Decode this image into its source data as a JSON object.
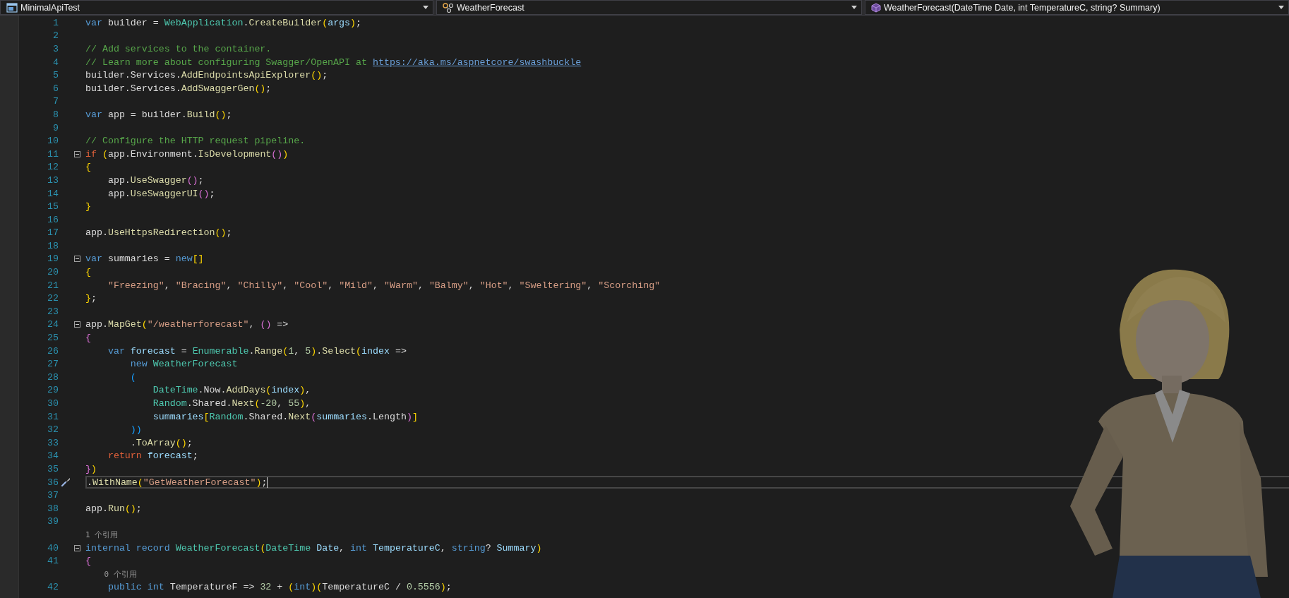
{
  "nav_bar": [
    {
      "label": "MinimalApiTest",
      "kind": "project"
    },
    {
      "label": "WeatherForecast",
      "kind": "class"
    },
    {
      "label": "WeatherForecast(DateTime Date, int TemperatureC, string? Summary)",
      "kind": "member"
    }
  ],
  "lines": [
    {
      "kind": "code",
      "number": "1",
      "fold": false,
      "current": false,
      "tokens": [
        {
          "kind": "kw",
          "text": "var"
        },
        {
          "kind": "p",
          "text": " builder = "
        },
        {
          "kind": "type",
          "text": "WebApplication"
        },
        {
          "kind": "p",
          "text": "."
        },
        {
          "kind": "fn",
          "text": "CreateBuilder"
        },
        {
          "kind": "b1",
          "text": "("
        },
        {
          "kind": "var",
          "text": "args"
        },
        {
          "kind": "b1",
          "text": ")"
        },
        {
          "kind": "p",
          "text": ";"
        }
      ]
    },
    {
      "kind": "code",
      "number": "2",
      "fold": false,
      "current": false
    },
    {
      "kind": "code",
      "number": "3",
      "fold": false,
      "current": false,
      "tokens": [
        {
          "kind": "cm",
          "text": "// Add services to the container."
        }
      ]
    },
    {
      "kind": "code",
      "number": "4",
      "fold": false,
      "current": false,
      "tokens": [
        {
          "kind": "cm",
          "text": "// Learn more about configuring Swagger/OpenAPI at "
        },
        {
          "kind": "link",
          "text": "https://aka.ms/aspnetcore/swashbuckle"
        }
      ]
    },
    {
      "kind": "code",
      "number": "5",
      "fold": false,
      "current": false,
      "tokens": [
        {
          "kind": "p",
          "text": "builder.Services."
        },
        {
          "kind": "fn",
          "text": "AddEndpointsApiExplorer"
        },
        {
          "kind": "b1",
          "text": "()"
        },
        {
          "kind": "p",
          "text": ";"
        }
      ]
    },
    {
      "kind": "code",
      "number": "6",
      "fold": false,
      "current": false,
      "tokens": [
        {
          "kind": "p",
          "text": "builder.Services."
        },
        {
          "kind": "fn",
          "text": "AddSwaggerGen"
        },
        {
          "kind": "b1",
          "text": "()"
        },
        {
          "kind": "p",
          "text": ";"
        }
      ]
    },
    {
      "kind": "code",
      "number": "7",
      "fold": false,
      "current": false
    },
    {
      "kind": "code",
      "number": "8",
      "fold": false,
      "current": false,
      "tokens": [
        {
          "kind": "kw",
          "text": "var"
        },
        {
          "kind": "p",
          "text": " app = builder."
        },
        {
          "kind": "fn",
          "text": "Build"
        },
        {
          "kind": "b1",
          "text": "()"
        },
        {
          "kind": "p",
          "text": ";"
        }
      ]
    },
    {
      "kind": "code",
      "number": "9",
      "fold": false,
      "current": false
    },
    {
      "kind": "code",
      "number": "10",
      "fold": false,
      "current": false,
      "tokens": [
        {
          "kind": "cm",
          "text": "// Configure the HTTP request pipeline."
        }
      ]
    },
    {
      "kind": "code",
      "number": "11",
      "fold": true,
      "current": false,
      "tokens": [
        {
          "kind": "ctl",
          "text": "if "
        },
        {
          "kind": "b1",
          "text": "("
        },
        {
          "kind": "p",
          "text": "app.Environment."
        },
        {
          "kind": "fn",
          "text": "IsDevelopment"
        },
        {
          "kind": "b2",
          "text": "()"
        },
        {
          "kind": "b1",
          "text": ")"
        }
      ]
    },
    {
      "kind": "code",
      "number": "12",
      "fold": false,
      "current": false,
      "tokens": [
        {
          "kind": "b1",
          "text": "{"
        }
      ]
    },
    {
      "kind": "code",
      "number": "13",
      "fold": false,
      "current": false,
      "tokens": [
        {
          "kind": "p",
          "text": "    app."
        },
        {
          "kind": "fn",
          "text": "UseSwagger"
        },
        {
          "kind": "b2",
          "text": "()"
        },
        {
          "kind": "p",
          "text": ";"
        }
      ]
    },
    {
      "kind": "code",
      "number": "14",
      "fold": false,
      "current": false,
      "tokens": [
        {
          "kind": "p",
          "text": "    app."
        },
        {
          "kind": "fn",
          "text": "UseSwaggerUI"
        },
        {
          "kind": "b2",
          "text": "()"
        },
        {
          "kind": "p",
          "text": ";"
        }
      ]
    },
    {
      "kind": "code",
      "number": "15",
      "fold": false,
      "current": false,
      "tokens": [
        {
          "kind": "b1",
          "text": "}"
        }
      ]
    },
    {
      "kind": "code",
      "number": "16",
      "fold": false,
      "current": false
    },
    {
      "kind": "code",
      "number": "17",
      "fold": false,
      "current": false,
      "tokens": [
        {
          "kind": "p",
          "text": "app."
        },
        {
          "kind": "fn",
          "text": "UseHttpsRedirection"
        },
        {
          "kind": "b1",
          "text": "()"
        },
        {
          "kind": "p",
          "text": ";"
        }
      ]
    },
    {
      "kind": "code",
      "number": "18",
      "fold": false,
      "current": false
    },
    {
      "kind": "code",
      "number": "19",
      "fold": true,
      "current": false,
      "tokens": [
        {
          "kind": "kw",
          "text": "var"
        },
        {
          "kind": "p",
          "text": " summaries = "
        },
        {
          "kind": "kw",
          "text": "new"
        },
        {
          "kind": "b1",
          "text": "[]"
        }
      ]
    },
    {
      "kind": "code",
      "number": "20",
      "fold": false,
      "current": false,
      "tokens": [
        {
          "kind": "b1",
          "text": "{"
        }
      ]
    },
    {
      "kind": "code",
      "number": "21",
      "fold": false,
      "current": false,
      "tokens": [
        {
          "kind": "str",
          "text": "    \"Freezing\""
        },
        {
          "kind": "p",
          "text": ", "
        },
        {
          "kind": "str",
          "text": "\"Bracing\""
        },
        {
          "kind": "p",
          "text": ", "
        },
        {
          "kind": "str",
          "text": "\"Chilly\""
        },
        {
          "kind": "p",
          "text": ", "
        },
        {
          "kind": "str",
          "text": "\"Cool\""
        },
        {
          "kind": "p",
          "text": ", "
        },
        {
          "kind": "str",
          "text": "\"Mild\""
        },
        {
          "kind": "p",
          "text": ", "
        },
        {
          "kind": "str",
          "text": "\"Warm\""
        },
        {
          "kind": "p",
          "text": ", "
        },
        {
          "kind": "str",
          "text": "\"Balmy\""
        },
        {
          "kind": "p",
          "text": ", "
        },
        {
          "kind": "str",
          "text": "\"Hot\""
        },
        {
          "kind": "p",
          "text": ", "
        },
        {
          "kind": "str",
          "text": "\"Sweltering\""
        },
        {
          "kind": "p",
          "text": ", "
        },
        {
          "kind": "str",
          "text": "\"Scorching\""
        }
      ]
    },
    {
      "kind": "code",
      "number": "22",
      "fold": false,
      "current": false,
      "tokens": [
        {
          "kind": "b1",
          "text": "}"
        },
        {
          "kind": "p",
          "text": ";"
        }
      ]
    },
    {
      "kind": "code",
      "number": "23",
      "fold": false,
      "current": false
    },
    {
      "kind": "code",
      "number": "24",
      "fold": true,
      "current": false,
      "tokens": [
        {
          "kind": "p",
          "text": "app."
        },
        {
          "kind": "fn",
          "text": "MapGet"
        },
        {
          "kind": "b1",
          "text": "("
        },
        {
          "kind": "str",
          "text": "\"/weatherforecast\""
        },
        {
          "kind": "p",
          "text": ", "
        },
        {
          "kind": "b2",
          "text": "()"
        },
        {
          "kind": "p",
          "text": " =>"
        }
      ]
    },
    {
      "kind": "code",
      "number": "25",
      "fold": false,
      "current": false,
      "tokens": [
        {
          "kind": "b2",
          "text": "{"
        }
      ]
    },
    {
      "kind": "code",
      "number": "26",
      "fold": false,
      "current": false,
      "tokens": [
        {
          "kind": "kw",
          "text": "    var "
        },
        {
          "kind": "var",
          "text": "forecast"
        },
        {
          "kind": "p",
          "text": " = "
        },
        {
          "kind": "type",
          "text": "Enumerable"
        },
        {
          "kind": "p",
          "text": "."
        },
        {
          "kind": "fn",
          "text": "Range"
        },
        {
          "kind": "b1",
          "text": "("
        },
        {
          "kind": "num",
          "text": "1"
        },
        {
          "kind": "p",
          "text": ", "
        },
        {
          "kind": "num",
          "text": "5"
        },
        {
          "kind": "b1",
          "text": ")"
        },
        {
          "kind": "p",
          "text": "."
        },
        {
          "kind": "fn",
          "text": "Select"
        },
        {
          "kind": "b1",
          "text": "("
        },
        {
          "kind": "var",
          "text": "index"
        },
        {
          "kind": "p",
          "text": " =>"
        }
      ]
    },
    {
      "kind": "code",
      "number": "27",
      "fold": false,
      "current": false,
      "tokens": [
        {
          "kind": "kw",
          "text": "        new "
        },
        {
          "kind": "type",
          "text": "WeatherForecast"
        }
      ]
    },
    {
      "kind": "code",
      "number": "28",
      "fold": false,
      "current": false,
      "tokens": [
        {
          "kind": "b3",
          "text": "        ("
        }
      ]
    },
    {
      "kind": "code",
      "number": "29",
      "fold": false,
      "current": false,
      "tokens": [
        {
          "kind": "type",
          "text": "            DateTime"
        },
        {
          "kind": "p",
          "text": ".Now."
        },
        {
          "kind": "fn",
          "text": "AddDays"
        },
        {
          "kind": "b1",
          "text": "("
        },
        {
          "kind": "var",
          "text": "index"
        },
        {
          "kind": "b1",
          "text": ")"
        },
        {
          "kind": "p",
          "text": ","
        }
      ]
    },
    {
      "kind": "code",
      "number": "30",
      "fold": false,
      "current": false,
      "tokens": [
        {
          "kind": "type",
          "text": "            Random"
        },
        {
          "kind": "p",
          "text": ".Shared."
        },
        {
          "kind": "fn",
          "text": "Next"
        },
        {
          "kind": "b1",
          "text": "("
        },
        {
          "kind": "num",
          "text": "-20"
        },
        {
          "kind": "p",
          "text": ", "
        },
        {
          "kind": "num",
          "text": "55"
        },
        {
          "kind": "b1",
          "text": ")"
        },
        {
          "kind": "p",
          "text": ","
        }
      ]
    },
    {
      "kind": "code",
      "number": "31",
      "fold": false,
      "current": false,
      "tokens": [
        {
          "kind": "var",
          "text": "            summaries"
        },
        {
          "kind": "b1",
          "text": "["
        },
        {
          "kind": "type",
          "text": "Random"
        },
        {
          "kind": "p",
          "text": ".Shared."
        },
        {
          "kind": "fn",
          "text": "Next"
        },
        {
          "kind": "b2",
          "text": "("
        },
        {
          "kind": "var",
          "text": "summaries"
        },
        {
          "kind": "p",
          "text": ".Length"
        },
        {
          "kind": "b2",
          "text": ")"
        },
        {
          "kind": "b1",
          "text": "]"
        }
      ]
    },
    {
      "kind": "code",
      "number": "32",
      "fold": false,
      "current": false,
      "tokens": [
        {
          "kind": "b3",
          "text": "        ))"
        }
      ]
    },
    {
      "kind": "code",
      "number": "33",
      "fold": false,
      "current": false,
      "tokens": [
        {
          "kind": "p",
          "text": "        ."
        },
        {
          "kind": "fn",
          "text": "ToArray"
        },
        {
          "kind": "b1",
          "text": "()"
        },
        {
          "kind": "p",
          "text": ";"
        }
      ]
    },
    {
      "kind": "code",
      "number": "34",
      "fold": false,
      "current": false,
      "tokens": [
        {
          "kind": "ctl",
          "text": "    return "
        },
        {
          "kind": "var",
          "text": "forecast"
        },
        {
          "kind": "p",
          "text": ";"
        }
      ]
    },
    {
      "kind": "code",
      "number": "35",
      "fold": false,
      "current": false,
      "tokens": [
        {
          "kind": "b2",
          "text": "}"
        },
        {
          "kind": "b1",
          "text": ")"
        }
      ]
    },
    {
      "kind": "code",
      "number": "36",
      "fold": false,
      "current": true,
      "tokens": [
        {
          "kind": "p",
          "text": "."
        },
        {
          "kind": "fn",
          "text": "WithName"
        },
        {
          "kind": "b1",
          "text": "("
        },
        {
          "kind": "str",
          "text": "\"GetWeatherForecast\""
        },
        {
          "kind": "b1",
          "text": ")"
        },
        {
          "kind": "p",
          "text": ";"
        }
      ]
    },
    {
      "kind": "code",
      "number": "37",
      "fold": false,
      "current": false
    },
    {
      "kind": "code",
      "number": "38",
      "fold": false,
      "current": false,
      "tokens": [
        {
          "kind": "p",
          "text": "app."
        },
        {
          "kind": "fn",
          "text": "Run"
        },
        {
          "kind": "b1",
          "text": "()"
        },
        {
          "kind": "p",
          "text": ";"
        }
      ]
    },
    {
      "kind": "code",
      "number": "39",
      "fold": false,
      "current": false
    },
    {
      "kind": "lens",
      "tokens": [
        {
          "kind": "lens",
          "text": "1 个引用"
        }
      ]
    },
    {
      "kind": "code",
      "number": "40",
      "fold": true,
      "current": false,
      "tokens": [
        {
          "kind": "kw",
          "text": "internal record "
        },
        {
          "kind": "type",
          "text": "WeatherForecast"
        },
        {
          "kind": "b1",
          "text": "("
        },
        {
          "kind": "type",
          "text": "DateTime "
        },
        {
          "kind": "var",
          "text": "Date"
        },
        {
          "kind": "p",
          "text": ", "
        },
        {
          "kind": "kw",
          "text": "int "
        },
        {
          "kind": "var",
          "text": "TemperatureC"
        },
        {
          "kind": "p",
          "text": ", "
        },
        {
          "kind": "kw",
          "text": "string"
        },
        {
          "kind": "p",
          "text": "? "
        },
        {
          "kind": "var",
          "text": "Summary"
        },
        {
          "kind": "b1",
          "text": ")"
        }
      ]
    },
    {
      "kind": "code",
      "number": "41",
      "fold": false,
      "current": false,
      "tokens": [
        {
          "kind": "b2",
          "text": "{"
        }
      ]
    },
    {
      "kind": "lens",
      "tokens": [
        {
          "kind": "lens",
          "text": "    0 个引用"
        }
      ]
    },
    {
      "kind": "code",
      "number": "42",
      "fold": false,
      "current": false,
      "tokens": [
        {
          "kind": "kw",
          "text": "    public int"
        },
        {
          "kind": "p",
          "text": " TemperatureF => "
        },
        {
          "kind": "num",
          "text": "32"
        },
        {
          "kind": "p",
          "text": " + "
        },
        {
          "kind": "b1",
          "text": "("
        },
        {
          "kind": "kw",
          "text": "int"
        },
        {
          "kind": "b1",
          "text": ")("
        },
        {
          "kind": "p",
          "text": "TemperatureC / "
        },
        {
          "kind": "num",
          "text": "0.5556"
        },
        {
          "kind": "b1",
          "text": ")"
        },
        {
          "kind": "p",
          "text": ";"
        }
      ]
    }
  ]
}
